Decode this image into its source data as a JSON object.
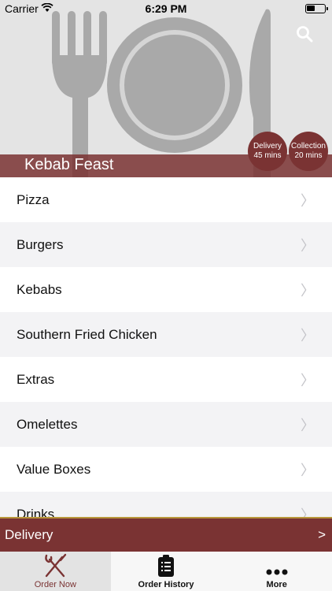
{
  "status_bar": {
    "carrier": "Carrier",
    "time": "6:29 PM"
  },
  "header": {
    "restaurant_name": "Kebab Feast"
  },
  "badges": {
    "delivery": {
      "label": "Delivery",
      "time": "45 mins"
    },
    "collection": {
      "label": "Collection",
      "time": "20 mins"
    }
  },
  "categories": [
    {
      "label": "Pizza"
    },
    {
      "label": "Burgers"
    },
    {
      "label": "Kebabs"
    },
    {
      "label": "Southern Fried Chicken"
    },
    {
      "label": "Extras"
    },
    {
      "label": "Omelettes"
    },
    {
      "label": "Value Boxes"
    },
    {
      "label": "Drinks"
    }
  ],
  "delivery_bar": {
    "label": "Delivery",
    "arrow": ">"
  },
  "tabs": [
    {
      "label": "Order Now",
      "icon": "fork-knife-icon"
    },
    {
      "label": "Order History",
      "icon": "clipboard-icon"
    },
    {
      "label": "More",
      "icon": "more-icon"
    }
  ],
  "colors": {
    "brand": "#7a3333",
    "gold": "#b8963a"
  }
}
